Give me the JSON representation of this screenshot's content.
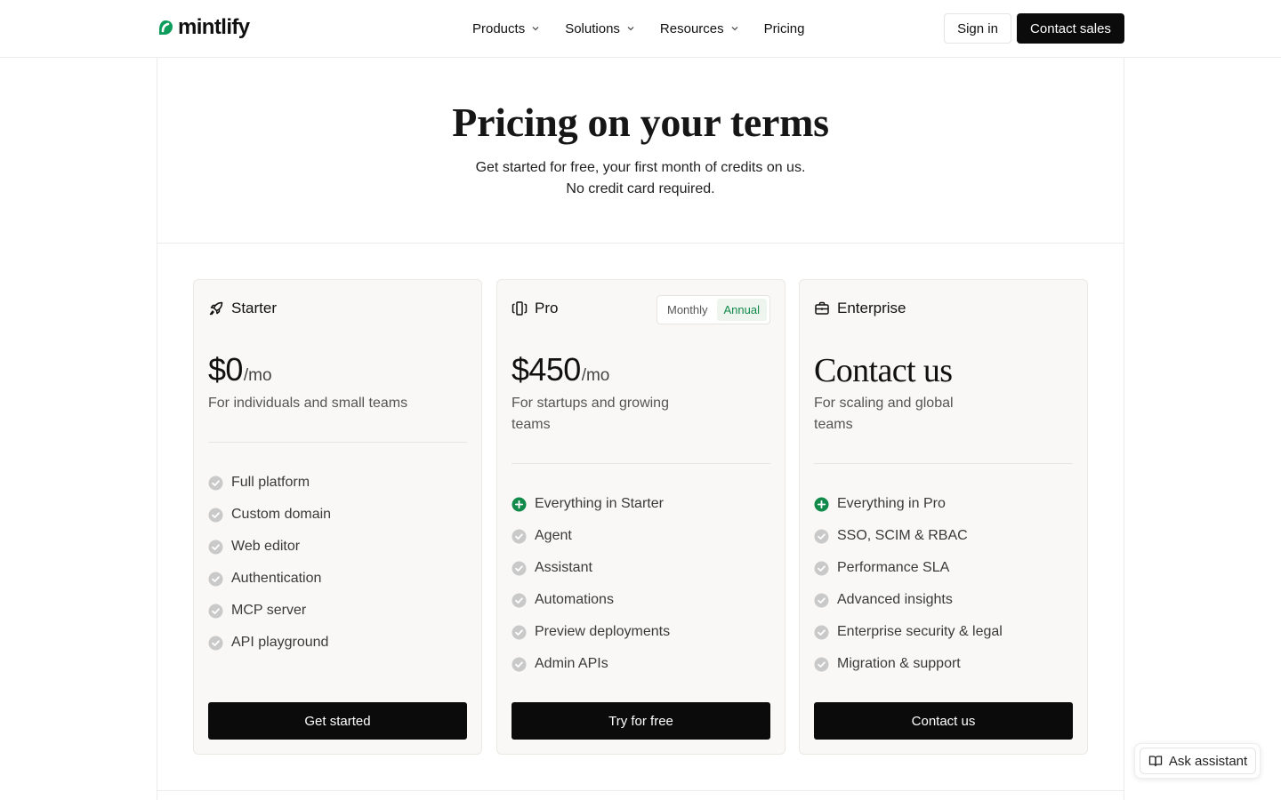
{
  "brand": {
    "name": "mintlify",
    "accent": "#0d9c5c"
  },
  "nav": {
    "items": [
      {
        "label": "Products",
        "has_menu": true
      },
      {
        "label": "Solutions",
        "has_menu": true
      },
      {
        "label": "Resources",
        "has_menu": true
      },
      {
        "label": "Pricing",
        "has_menu": false
      }
    ],
    "sign_in": "Sign in",
    "contact_sales": "Contact sales"
  },
  "hero": {
    "title": "Pricing on your terms",
    "subtitle_line1": "Get started for free, your first month of credits on us.",
    "subtitle_line2": "No credit card required."
  },
  "plans": [
    {
      "name": "Starter",
      "icon": "rocket-icon",
      "price": "$0",
      "period": "/mo",
      "description": "For individuals and small teams",
      "features": [
        "Full platform",
        "Custom domain",
        "Web editor",
        "Authentication",
        "MCP server",
        "API playground"
      ],
      "cta": "Get started"
    },
    {
      "name": "Pro",
      "icon": "columns-icon",
      "billing_toggle": {
        "options": [
          "Monthly",
          "Annual"
        ],
        "selected": "Annual"
      },
      "price": "$450",
      "period": "/mo",
      "description": "For startups and growing teams",
      "highlight_feature": "Everything in Starter",
      "features": [
        "Agent",
        "Assistant",
        "Automations",
        "Preview deployments",
        "Admin APIs"
      ],
      "cta": "Try for free"
    },
    {
      "name": "Enterprise",
      "icon": "briefcase-icon",
      "price": "Contact us",
      "description": "For scaling and global teams",
      "highlight_feature": "Everything in Pro",
      "features": [
        "SSO, SCIM & RBAC",
        "Performance SLA",
        "Advanced insights",
        "Enterprise security & legal",
        "Migration & support"
      ],
      "cta": "Contact us"
    }
  ],
  "assistant": {
    "label": "Ask assistant",
    "icon": "book-open-icon"
  },
  "colors": {
    "check_gray": "#c9c9c9",
    "plus_green": "#118a4a",
    "toggle_active": "#118a4a"
  }
}
